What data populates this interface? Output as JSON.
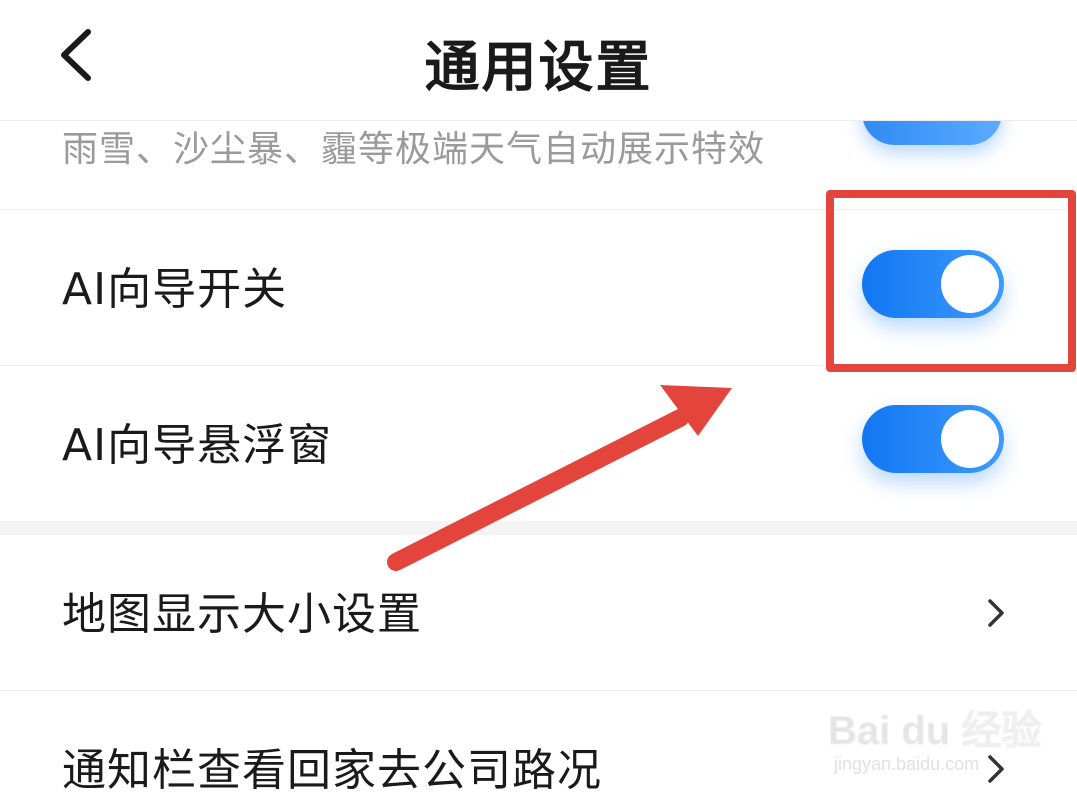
{
  "header": {
    "title": "通用设置",
    "back_icon": "chevron-left-icon"
  },
  "settings": {
    "weather_effects_desc": "雨雪、沙尘暴、霾等极端天气自动展示特效",
    "weather_effects_toggle": true,
    "ai_guide_switch": {
      "label": "AI向导开关",
      "enabled": true
    },
    "ai_guide_float": {
      "label": "AI向导悬浮窗",
      "enabled": true
    },
    "map_size": {
      "label": "地图显示大小设置",
      "icon": "chevron-right-icon"
    },
    "notify_traffic": {
      "label": "通知栏查看回家去公司路况",
      "icon": "chevron-right-icon"
    }
  },
  "annotation": {
    "highlight_color": "#e3443c",
    "arrow_color": "#e3443c"
  },
  "watermark": {
    "brand": "Bai du 经验",
    "url": "jingyan.baidu.com"
  },
  "colors": {
    "toggle_on": "#1a7ef5",
    "text_primary": "#1a1a1a",
    "text_secondary": "#9a9a9a"
  }
}
